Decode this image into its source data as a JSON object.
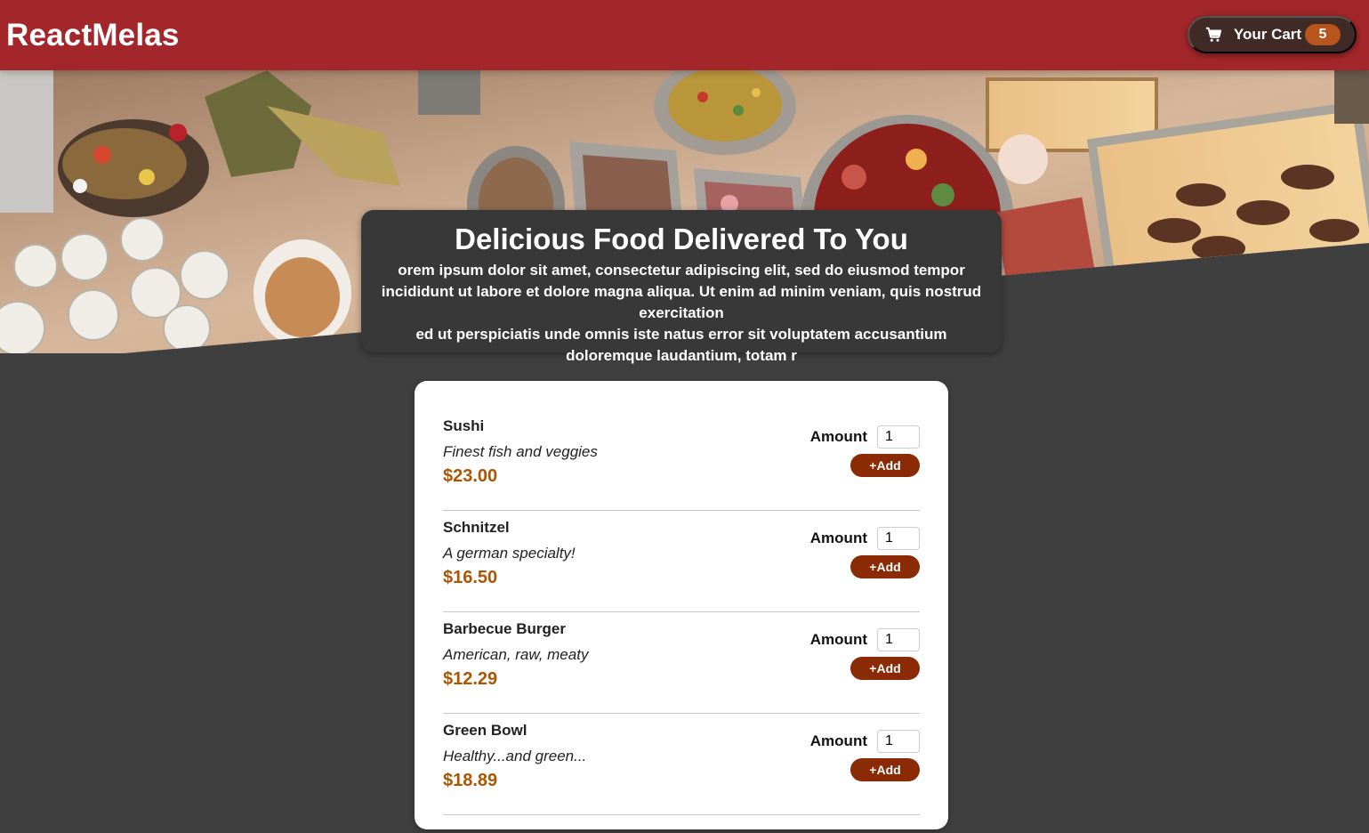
{
  "header": {
    "brand": "ReactMelas",
    "cart": {
      "label": "Your Cart",
      "count": "5",
      "icon": "cart-icon"
    }
  },
  "hero": {
    "image": "food-buffet-table-photo"
  },
  "summary": {
    "title": "Delicious Food Delivered To You",
    "text_line1": "orem ipsum dolor sit amet, consectetur adipiscing elit, sed do eiusmod tempor incididunt ut labore et dolore magna aliqua. Ut enim ad minim veniam, quis nostrud exercitation",
    "text_line2": "ed ut perspiciatis unde omnis iste natus error sit voluptatem accusantium doloremque laudantium, totam r"
  },
  "meals": [
    {
      "name": "Sushi",
      "description": "Finest fish and veggies",
      "price": "$23.00",
      "amount_label": "Amount",
      "amount": "1",
      "add_label": "+Add"
    },
    {
      "name": "Schnitzel",
      "description": "A german specialty!",
      "price": "$16.50",
      "amount_label": "Amount",
      "amount": "1",
      "add_label": "+Add"
    },
    {
      "name": "Barbecue Burger",
      "description": "American, raw, meaty",
      "price": "$12.29",
      "amount_label": "Amount",
      "amount": "1",
      "add_label": "+Add"
    },
    {
      "name": "Green Bowl",
      "description": "Healthy...and green...",
      "price": "$18.89",
      "amount_label": "Amount",
      "amount": "1",
      "add_label": "+Add"
    }
  ],
  "colors": {
    "header": "#a3272a",
    "background": "#3f3f3f",
    "price": "#ad5502",
    "add_button": "#8a2b06",
    "cart_button": "#3f2a26",
    "badge": "#b9541c"
  }
}
